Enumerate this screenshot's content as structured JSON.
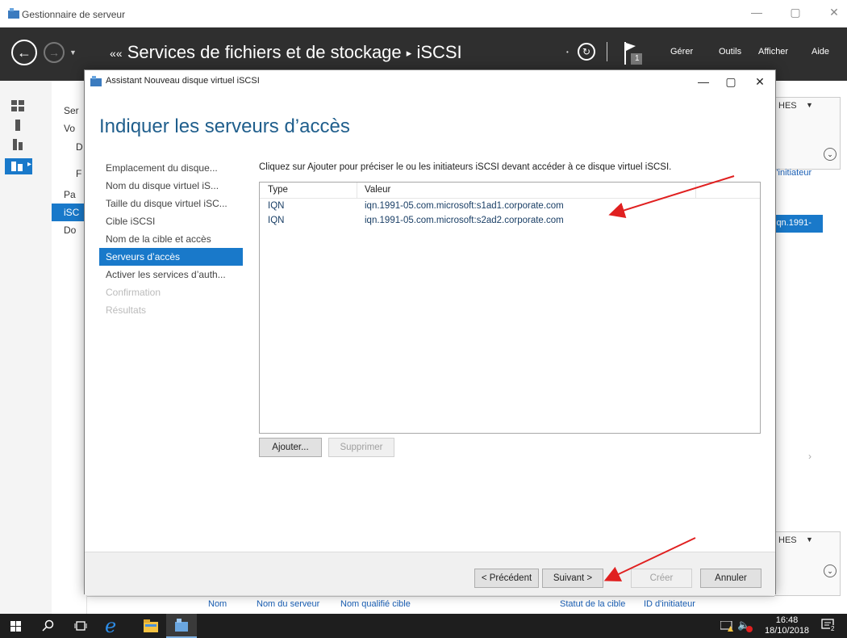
{
  "window": {
    "title": "Gestionnaire de serveur",
    "minimize": "—",
    "maximize": "▢",
    "close": "✕"
  },
  "header": {
    "breadcrumb_prefix": "««",
    "breadcrumb_root": "Services de fichiers et de stockage",
    "breadcrumb_sep": "▸",
    "breadcrumb_current": "iSCSI",
    "flag_count": "1",
    "menus": [
      "Gérer",
      "Outils",
      "Afficher",
      "Aide"
    ]
  },
  "nav": {
    "items": [
      "Ser",
      "Vo",
      "D",
      "F",
      "Pa",
      "iSC",
      "Do"
    ]
  },
  "right_pane": {
    "tasks_1": "HES",
    "col_header": "l'initiateur",
    "iqn_fragment": "iqn.1991-",
    "tasks_2": "HES"
  },
  "bottom_headers": [
    "Nom",
    "Nom du serveur",
    "Nom qualifié cible",
    "Statut de la cible",
    "ID d'initiateur"
  ],
  "dialog": {
    "title": "Assistant Nouveau disque virtuel iSCSI",
    "heading": "Indiquer les serveurs d’accès",
    "steps": [
      {
        "label": "Emplacement du disque...",
        "state": "done"
      },
      {
        "label": "Nom du disque virtuel iS...",
        "state": "done"
      },
      {
        "label": "Taille du disque virtuel iSC...",
        "state": "done"
      },
      {
        "label": "Cible iSCSI",
        "state": "done"
      },
      {
        "label": "Nom de la cible et accès",
        "state": "done"
      },
      {
        "label": "Serveurs d’accès",
        "state": "active"
      },
      {
        "label": "Activer les services d’auth...",
        "state": "done"
      },
      {
        "label": "Confirmation",
        "state": "disabled"
      },
      {
        "label": "Résultats",
        "state": "disabled"
      }
    ],
    "instructions": "Cliquez sur Ajouter pour préciser le ou les initiateurs iSCSI devant accéder à ce disque virtuel iSCSI.",
    "columns": [
      "Type",
      "Valeur"
    ],
    "rows": [
      {
        "type": "IQN",
        "value": "iqn.1991-05.com.microsoft:s1ad1.corporate.com"
      },
      {
        "type": "IQN",
        "value": "iqn.1991-05.com.microsoft:s2ad2.corporate.com"
      }
    ],
    "add_button": "Ajouter...",
    "remove_button": "Supprimer",
    "prev_button": "< Précédent",
    "next_button": "Suivant >",
    "create_button": "Créer",
    "cancel_button": "Annuler"
  },
  "taskbar": {
    "time": "16:48",
    "date": "18/10/2018",
    "notifications": "2"
  },
  "colors": {
    "accent": "#1979ca",
    "heading": "#1f5e8c",
    "arrow": "#e02020",
    "header_bg": "#2f2f2f"
  }
}
